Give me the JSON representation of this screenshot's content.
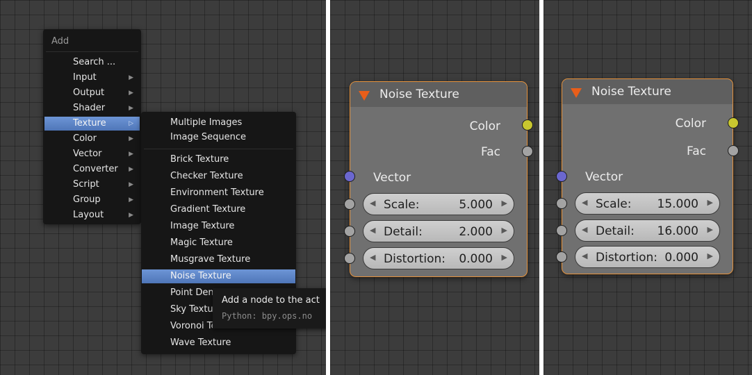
{
  "add_menu": {
    "title": "Add",
    "items": [
      {
        "label": "Search ...",
        "submenu": false
      },
      {
        "label": "Input",
        "submenu": true
      },
      {
        "label": "Output",
        "submenu": true
      },
      {
        "label": "Shader",
        "submenu": true
      },
      {
        "label": "Texture",
        "submenu": true,
        "active": true
      },
      {
        "label": "Color",
        "submenu": true
      },
      {
        "label": "Vector",
        "submenu": true
      },
      {
        "label": "Converter",
        "submenu": true
      },
      {
        "label": "Script",
        "submenu": true
      },
      {
        "label": "Group",
        "submenu": true
      },
      {
        "label": "Layout",
        "submenu": true
      }
    ]
  },
  "texture_menu": {
    "items": [
      {
        "label": "Multiple Images"
      },
      {
        "label": "Image Sequence"
      },
      {
        "label": "Brick Texture"
      },
      {
        "label": "Checker Texture"
      },
      {
        "label": "Environment Texture"
      },
      {
        "label": "Gradient Texture"
      },
      {
        "label": "Image Texture"
      },
      {
        "label": "Magic Texture"
      },
      {
        "label": "Musgrave Texture"
      },
      {
        "label": "Noise Texture",
        "active": true
      },
      {
        "label": "Point Density"
      },
      {
        "label": "Sky Texture"
      },
      {
        "label": "Voronoi Texture"
      },
      {
        "label": "Wave Texture"
      }
    ]
  },
  "tooltip": {
    "text": "Add a node to the act",
    "python": "Python: bpy.ops.no"
  },
  "node_a": {
    "title": "Noise Texture",
    "outputs": [
      "Color",
      "Fac"
    ],
    "input": "Vector",
    "fields": [
      {
        "name": "Scale:",
        "value": "5.000"
      },
      {
        "name": "Detail:",
        "value": "2.000"
      },
      {
        "name": "Distortion:",
        "value": "0.000"
      }
    ]
  },
  "node_b": {
    "title": "Noise Texture",
    "outputs": [
      "Color",
      "Fac"
    ],
    "input": "Vector",
    "fields": [
      {
        "name": "Scale:",
        "value": "15.000"
      },
      {
        "name": "Detail:",
        "value": "16.000"
      },
      {
        "name": "Distortion:",
        "value": "0.000"
      }
    ]
  },
  "icons": {
    "submenu_arrow": "chevron-right-icon",
    "collapse": "triangle-down-icon",
    "field_left": "arrow-left-icon",
    "field_right": "arrow-right-icon"
  },
  "colors": {
    "highlight": "#5b84c8",
    "node_border": "#e7933c",
    "socket_color": "#c8c72f",
    "socket_float": "#a3a3a3",
    "socket_vector": "#6b67cf",
    "collapse_triangle": "#e85e1a"
  }
}
